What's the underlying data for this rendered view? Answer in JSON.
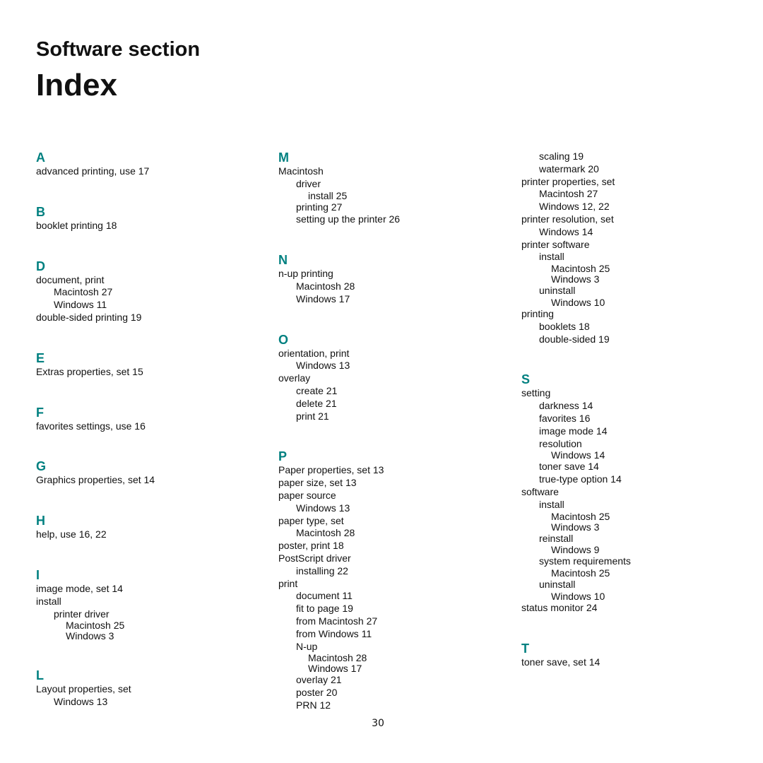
{
  "header": {
    "section_title": "Software section",
    "page_title": "Index"
  },
  "accent_color": "#008080",
  "columns": [
    {
      "groups": [
        {
          "letter": "A",
          "entries": [
            {
              "level": 0,
              "text": "advanced printing, use 17"
            }
          ]
        },
        {
          "letter": "B",
          "entries": [
            {
              "level": 0,
              "text": "booklet printing 18"
            }
          ]
        },
        {
          "letter": "D",
          "entries": [
            {
              "level": 0,
              "text": "document, print"
            },
            {
              "level": 1,
              "text": "Macintosh 27"
            },
            {
              "level": 1,
              "text": "Windows 11"
            },
            {
              "level": 0,
              "text": "double-sided printing 19"
            }
          ]
        },
        {
          "letter": "E",
          "entries": [
            {
              "level": 0,
              "text": "Extras properties, set 15"
            }
          ]
        },
        {
          "letter": "F",
          "entries": [
            {
              "level": 0,
              "text": "favorites settings, use 16"
            }
          ]
        },
        {
          "letter": "G",
          "entries": [
            {
              "level": 0,
              "text": "Graphics properties, set 14"
            }
          ]
        },
        {
          "letter": "H",
          "entries": [
            {
              "level": 0,
              "text": "help, use 16, 22"
            }
          ]
        },
        {
          "letter": "I",
          "entries": [
            {
              "level": 0,
              "text": "image mode, set 14"
            },
            {
              "level": 0,
              "text": "install"
            },
            {
              "level": 1,
              "text": "printer driver"
            },
            {
              "level": 2,
              "text": "Macintosh 25"
            },
            {
              "level": 2,
              "text": "Windows 3"
            }
          ]
        },
        {
          "letter": "L",
          "entries": [
            {
              "level": 0,
              "text": "Layout properties, set"
            },
            {
              "level": 1,
              "text": "Windows 13"
            }
          ]
        }
      ]
    },
    {
      "groups": [
        {
          "letter": "M",
          "entries": [
            {
              "level": 0,
              "text": "Macintosh"
            },
            {
              "level": 1,
              "text": "driver"
            },
            {
              "level": 2,
              "text": "install 25"
            },
            {
              "level": 1,
              "text": "printing 27"
            },
            {
              "level": 1,
              "text": "setting up the printer 26"
            }
          ]
        },
        {
          "letter": "N",
          "entries": [
            {
              "level": 0,
              "text": "n-up printing"
            },
            {
              "level": 1,
              "text": "Macintosh 28"
            },
            {
              "level": 1,
              "text": "Windows 17"
            }
          ]
        },
        {
          "letter": "O",
          "entries": [
            {
              "level": 0,
              "text": "orientation, print"
            },
            {
              "level": 1,
              "text": "Windows 13"
            },
            {
              "level": 0,
              "text": "overlay"
            },
            {
              "level": 1,
              "text": "create 21"
            },
            {
              "level": 1,
              "text": "delete 21"
            },
            {
              "level": 1,
              "text": "print 21"
            }
          ]
        },
        {
          "letter": "P",
          "entries": [
            {
              "level": 0,
              "text": "Paper properties, set 13"
            },
            {
              "level": 0,
              "text": "paper size, set 13"
            },
            {
              "level": 0,
              "text": "paper source"
            },
            {
              "level": 1,
              "text": "Windows 13"
            },
            {
              "level": 0,
              "text": "paper type, set"
            },
            {
              "level": 1,
              "text": "Macintosh 28"
            },
            {
              "level": 0,
              "text": "poster, print 18"
            },
            {
              "level": 0,
              "text": "PostScript driver"
            },
            {
              "level": 1,
              "text": "installing 22"
            },
            {
              "level": 0,
              "text": "print"
            },
            {
              "level": 1,
              "text": "document 11"
            },
            {
              "level": 1,
              "text": "fit to page 19"
            },
            {
              "level": 1,
              "text": "from Macintosh 27"
            },
            {
              "level": 1,
              "text": "from Windows 11"
            },
            {
              "level": 1,
              "text": "N-up"
            },
            {
              "level": 2,
              "text": "Macintosh 28"
            },
            {
              "level": 2,
              "text": "Windows 17"
            },
            {
              "level": 1,
              "text": "overlay 21"
            },
            {
              "level": 1,
              "text": "poster 20"
            },
            {
              "level": 1,
              "text": "PRN 12"
            }
          ]
        }
      ]
    },
    {
      "groups": [
        {
          "letter": "",
          "entries": [
            {
              "level": 1,
              "text": "scaling 19"
            },
            {
              "level": 1,
              "text": "watermark 20"
            },
            {
              "level": 0,
              "text": "printer properties, set"
            },
            {
              "level": 1,
              "text": "Macintosh 27"
            },
            {
              "level": 1,
              "text": "Windows 12, 22"
            },
            {
              "level": 0,
              "text": "printer resolution, set"
            },
            {
              "level": 1,
              "text": "Windows 14"
            },
            {
              "level": 0,
              "text": "printer software"
            },
            {
              "level": 1,
              "text": "install"
            },
            {
              "level": 2,
              "text": "Macintosh 25"
            },
            {
              "level": 2,
              "text": "Windows 3"
            },
            {
              "level": 1,
              "text": "uninstall"
            },
            {
              "level": 2,
              "text": "Windows 10"
            },
            {
              "level": 0,
              "text": "printing"
            },
            {
              "level": 1,
              "text": "booklets 18"
            },
            {
              "level": 1,
              "text": "double-sided 19"
            }
          ]
        },
        {
          "letter": "S",
          "entries": [
            {
              "level": 0,
              "text": "setting"
            },
            {
              "level": 1,
              "text": "darkness 14"
            },
            {
              "level": 1,
              "text": "favorites 16"
            },
            {
              "level": 1,
              "text": "image mode 14"
            },
            {
              "level": 1,
              "text": "resolution"
            },
            {
              "level": 2,
              "text": "Windows 14"
            },
            {
              "level": 1,
              "text": "toner save 14"
            },
            {
              "level": 1,
              "text": "true-type option 14"
            },
            {
              "level": 0,
              "text": "software"
            },
            {
              "level": 1,
              "text": "install"
            },
            {
              "level": 2,
              "text": "Macintosh 25"
            },
            {
              "level": 2,
              "text": "Windows 3"
            },
            {
              "level": 1,
              "text": "reinstall"
            },
            {
              "level": 2,
              "text": "Windows 9"
            },
            {
              "level": 1,
              "text": "system requirements"
            },
            {
              "level": 2,
              "text": "Macintosh 25"
            },
            {
              "level": 1,
              "text": "uninstall"
            },
            {
              "level": 2,
              "text": "Windows 10"
            },
            {
              "level": 0,
              "text": "status monitor 24"
            }
          ]
        },
        {
          "letter": "T",
          "entries": [
            {
              "level": 0,
              "text": "toner save, set 14"
            }
          ]
        }
      ]
    }
  ],
  "footer": {
    "page_number": "30"
  }
}
